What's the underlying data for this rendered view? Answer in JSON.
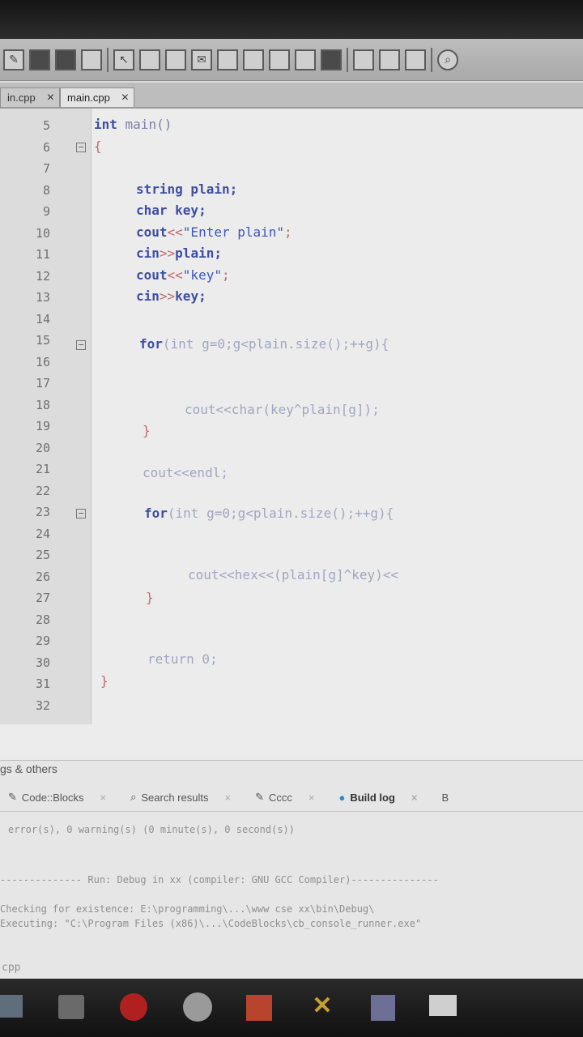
{
  "tabs": [
    {
      "label": "in.cpp",
      "close": "×"
    },
    {
      "label": "main.cpp",
      "close": "×"
    }
  ],
  "editor": {
    "line_numbers": [
      "5",
      "6",
      "7",
      "8",
      "9",
      "10",
      "11",
      "12",
      "13",
      "14",
      "15",
      "16",
      "17",
      "18",
      "19",
      "20",
      "21",
      "22",
      "23",
      "24",
      "25",
      "26",
      "27",
      "28",
      "29",
      "30",
      "31",
      "32"
    ],
    "fold_marker": "−",
    "lines": {
      "l5": {
        "k1": "int",
        "t1": " main()"
      },
      "l6": {
        "t1": "{"
      },
      "l8": {
        "k1": "string",
        "t1": " plain;"
      },
      "l9": {
        "k1": "char",
        "t1": " key;"
      },
      "l10": {
        "t1": "cout",
        "op": "<<",
        "s": "\"Enter plain\"",
        "t2": ";"
      },
      "l11": {
        "t1": "cin",
        "op": ">>",
        "t2": "plain;"
      },
      "l12": {
        "t1": "cout",
        "op": "<<",
        "s": "\"key\"",
        "t2": ";"
      },
      "l13": {
        "t1": "cin",
        "op": ">>",
        "t2": "key;"
      },
      "l15": {
        "k1": "for",
        "t1": "(int g=0;g<plain.size();++g){"
      },
      "l18": {
        "t1": "cout<<char(key^plain[g]);"
      },
      "l19": {
        "t1": "}"
      },
      "l21": {
        "t1": "cout<<endl;"
      },
      "l23": {
        "k1": "for",
        "t1": "(int g=0;g<plain.size();++g){"
      },
      "l26": {
        "t1": "cout<<hex<<(plain[g]^key)<<"
      },
      "l27": {
        "t1": "}"
      },
      "l30": {
        "t1": "return 0;"
      },
      "l31": {
        "t1": "}"
      }
    }
  },
  "logs": {
    "title": "gs & others",
    "tabs": [
      {
        "label": "Code::Blocks",
        "close": "×"
      },
      {
        "label": "Search results",
        "close": "×"
      },
      {
        "label": "Cccc",
        "close": "×"
      },
      {
        "label": "Build log",
        "close": "×"
      },
      {
        "label": "B"
      }
    ],
    "lines": [
      "error(s), 0 warning(s) (0 minute(s), 0 second(s))",
      "-------------- Run: Debug in xx (compiler: GNU GCC Compiler)---------------",
      "Checking for existence: E:\\programming\\...\\www cse xx\\bin\\Debug\\",
      "Executing: \"C:\\Program Files (x86)\\...\\CodeBlocks\\cb_console_runner.exe\""
    ],
    "footer": "cpp"
  }
}
